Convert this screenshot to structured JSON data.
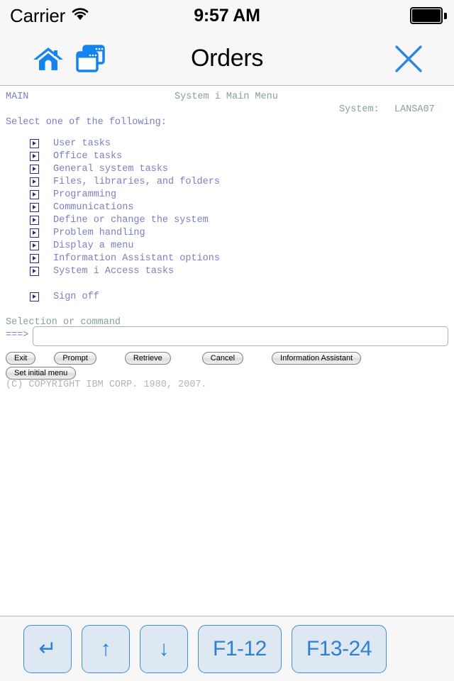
{
  "status_bar": {
    "carrier": "Carrier",
    "wifi_icon": "wifi-icon",
    "time": "9:57 AM",
    "battery_icon": "battery-full-icon"
  },
  "nav_bar": {
    "title": "Orders",
    "home_icon": "home-icon",
    "sessions_icon": "sessions-windows-icon",
    "close_icon": "close-x-icon",
    "accent_color": "#1383f0"
  },
  "terminal": {
    "screen_id": "MAIN",
    "screen_title": "System i Main Menu",
    "system_label": "System:",
    "system_name": "LANSA07",
    "prompt_text": "Select one of the following:",
    "menu_options": [
      {
        "label": "User tasks"
      },
      {
        "label": "Office tasks"
      },
      {
        "label": "General system tasks"
      },
      {
        "label": "Files, libraries, and folders"
      },
      {
        "label": "Programming"
      },
      {
        "label": "Communications"
      },
      {
        "label": "Define or change the system"
      },
      {
        "label": "Problem handling"
      },
      {
        "label": "Display a menu"
      },
      {
        "label": "Information Assistant options"
      },
      {
        "label": "System i Access tasks"
      },
      {
        "label": "Sign off"
      }
    ],
    "command_label": "Selection or command",
    "command_arrow": "===>",
    "command_value": "",
    "command_placeholder": "",
    "function_keys_row1": [
      "Exit",
      "Prompt",
      "Retrieve",
      "Cancel",
      "Information Assistant"
    ],
    "function_keys_row2": [
      "Set initial menu"
    ],
    "copyright": "(C) COPYRIGHT IBM CORP. 1980, 2007.",
    "colors": {
      "blue_text": "#7b7fc4",
      "green_text": "#84a58e",
      "gray_text": "#b4b4b4",
      "option_box": "#2b2f7a"
    }
  },
  "toolbar": {
    "keys": [
      {
        "name": "enter-key",
        "label": "↵",
        "style": "sq"
      },
      {
        "name": "page-up-key",
        "label": "↑",
        "style": "sq"
      },
      {
        "name": "page-down-key",
        "label": "↓",
        "style": "sq"
      },
      {
        "name": "f1-12-key",
        "label": "F1-12",
        "style": "wide"
      },
      {
        "name": "f13-24-key",
        "label": "F13-24",
        "style": "wide"
      }
    ]
  }
}
